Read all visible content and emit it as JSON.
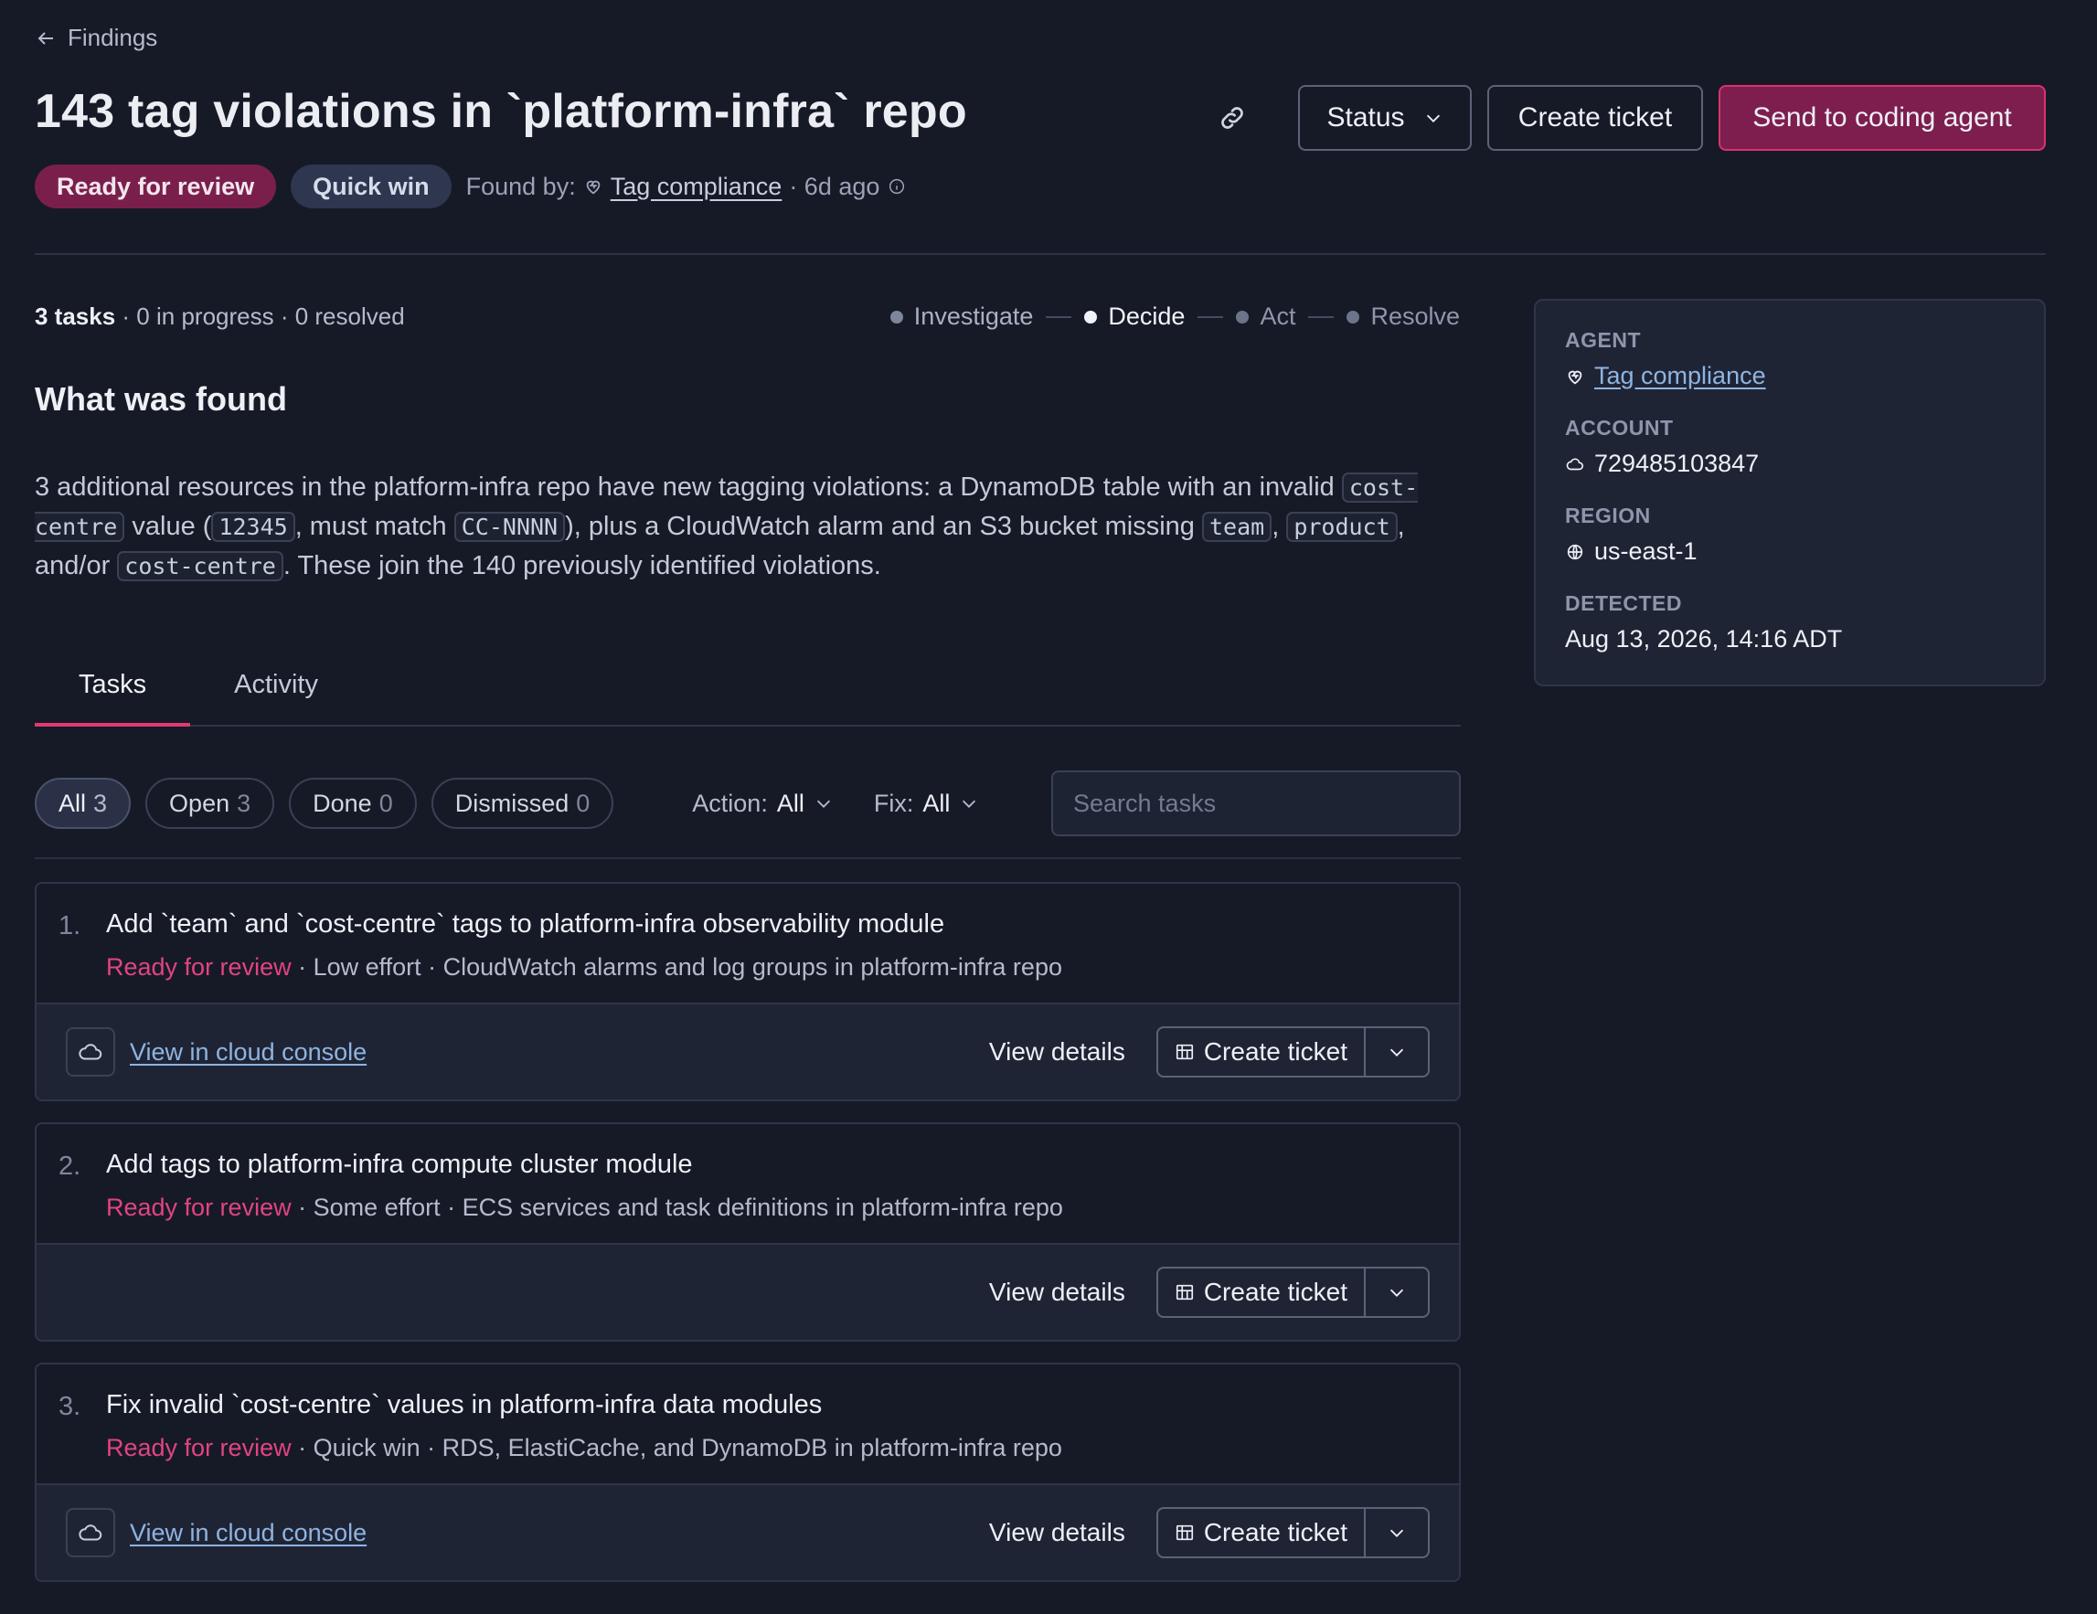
{
  "nav": {
    "back_label": "Findings"
  },
  "header": {
    "title": "143 tag violations in `platform-infra` repo",
    "status_label": "Status",
    "create_ticket_label": "Create ticket",
    "send_agent_label": "Send to coding agent"
  },
  "meta": {
    "status_pill": "Ready for review",
    "effort_pill": "Quick win",
    "found_by_label": "Found by:",
    "agent_name": "Tag compliance",
    "age": "· 6d ago"
  },
  "summary": {
    "tasks_count": "3 tasks",
    "rest": "· 0 in progress · 0 resolved"
  },
  "stepper": [
    "Investigate",
    "Decide",
    "Act",
    "Resolve"
  ],
  "found_section": {
    "heading": "What was found",
    "p1": "3 additional resources in the platform-infra repo have new tagging violations: a DynamoDB table with an invalid ",
    "c1": "cost-centre",
    "p2": " value (",
    "c2": "12345",
    "p3": ", must match ",
    "c3": "CC-NNNN",
    "p4": "), plus a CloudWatch alarm and an S3 bucket missing ",
    "c4": "team",
    "p5": ", ",
    "c5": "product",
    "p6": ", and/or ",
    "c6": "cost-centre",
    "p7": ". These join the 140 previously identified violations."
  },
  "tabs": [
    "Tasks",
    "Activity"
  ],
  "filters": {
    "chips": [
      {
        "label": "All",
        "count": "3"
      },
      {
        "label": "Open",
        "count": "3"
      },
      {
        "label": "Done",
        "count": "0"
      },
      {
        "label": "Dismissed",
        "count": "0"
      }
    ],
    "action_label": "Action:",
    "action_value": "All",
    "fix_label": "Fix:",
    "fix_value": "All",
    "search_placeholder": "Search tasks"
  },
  "tasks": [
    {
      "num": "1.",
      "title": "Add `team` and `cost-centre` tags to platform-infra observability module",
      "state": "Ready for review",
      "detail": " · Low effort · CloudWatch alarms and log groups in platform-infra repo",
      "console_link": "View in cloud console",
      "view_details": "View details",
      "create_ticket": "Create ticket"
    },
    {
      "num": "2.",
      "title": "Add tags to platform-infra compute cluster module",
      "state": "Ready for review",
      "detail": " · Some effort · ECS services and task definitions in platform-infra repo",
      "view_details": "View details",
      "create_ticket": "Create ticket"
    },
    {
      "num": "3.",
      "title": "Fix invalid `cost-centre` values in platform-infra data modules",
      "state": "Ready for review",
      "detail": " · Quick win · RDS, ElastiCache, and DynamoDB in platform-infra repo",
      "console_link": "View in cloud console",
      "view_details": "View details",
      "create_ticket": "Create ticket"
    }
  ],
  "info_panel": {
    "agent_label": "AGENT",
    "agent_value": "Tag compliance",
    "account_label": "ACCOUNT",
    "account_value": "729485103847",
    "region_label": "REGION",
    "region_value": "us-east-1",
    "detected_label": "DETECTED",
    "detected_value": "Aug 13, 2026, 14:16 ADT"
  },
  "colors": {
    "background": "#161a27",
    "accent": "#e2386f",
    "primary_button": "#7e1e4e",
    "state_text": "#e2447e",
    "link": "#8fb4e0"
  },
  "icons": [
    "arrow-left-icon",
    "link-icon",
    "chevron-down-icon",
    "heart-agent-icon",
    "info-icon",
    "cloud-icon",
    "globe-icon",
    "ticket-icon"
  ]
}
